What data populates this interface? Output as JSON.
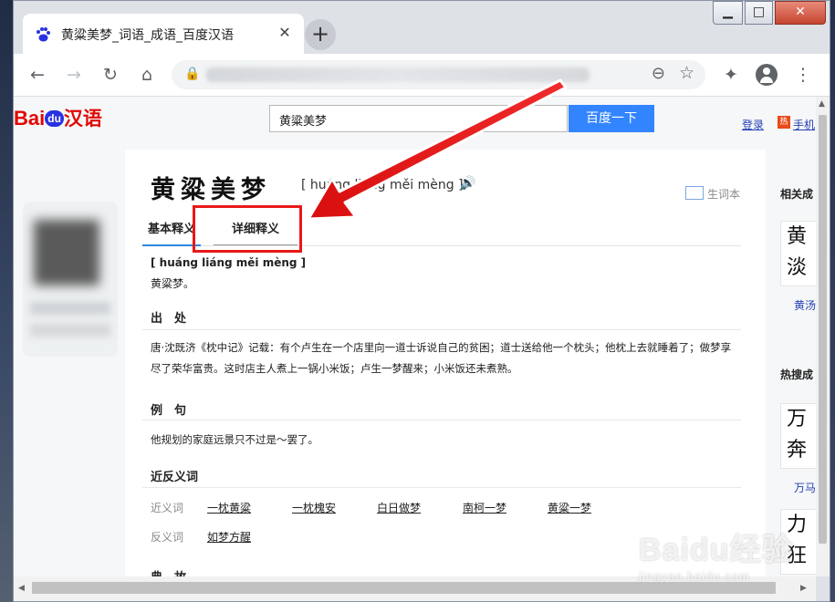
{
  "browser": {
    "tab_title": "黄粱美梦_词语_成语_百度汉语",
    "new_tab": "+",
    "close_tab": "✕",
    "window_controls": {
      "minimize": "▁",
      "maximize": "□",
      "close": "✕"
    }
  },
  "header": {
    "logo_text": "Bai",
    "logo_du": "du",
    "logo_hanyu": "汉语",
    "search_value": "黄粱美梦",
    "search_button": "百度一下",
    "login": "登录",
    "hot_badge": "热",
    "hand_link": "手机"
  },
  "main": {
    "word": "黄粱美梦",
    "pinyin": "[ huáng liáng měi mèng ]",
    "add_vocab": "生词本",
    "tabs": [
      "基本释义",
      "详细释义"
    ],
    "small_pinyin": "[ huáng liáng měi mèng ]",
    "definition": "黄粱梦。",
    "origin_title": "出　处",
    "origin_text": "唐·沈既济《枕中记》记载：有个卢生在一个店里向一道士诉说自己的贫困；道士送给他一个枕头；他枕上去就睡着了；做梦享尽了荣华富贵。这时店主人煮上一锅小米饭；卢生一梦醒来；小米饭还未煮熟。",
    "example_title": "例　句",
    "example_text": "他规划的家庭远景只不过是～罢了。",
    "related_title": "近反义词",
    "synonym_label": "近义词",
    "synonyms": [
      "一枕黄粱",
      "一枕槐安",
      "白日做梦",
      "南柯一梦",
      "黄粱一梦"
    ],
    "antonym_label": "反义词",
    "antonyms": [
      "如梦方醒"
    ],
    "story_title": "典　故"
  },
  "right": {
    "related_head": "相关成",
    "card1": [
      "黄",
      "淡"
    ],
    "card1_link": "黄汤",
    "hot_head": "热搜成",
    "card2": [
      "万",
      "奔"
    ],
    "card2_link": "万马",
    "card3": [
      "力",
      "狂"
    ]
  },
  "watermark": {
    "line1": "Baidu经验",
    "line2": "jingyan.baidu.com"
  },
  "colors": {
    "accent": "#3385ff",
    "annotation": "#e81818",
    "logo_red": "#e10602",
    "logo_blue": "#2932e1"
  }
}
